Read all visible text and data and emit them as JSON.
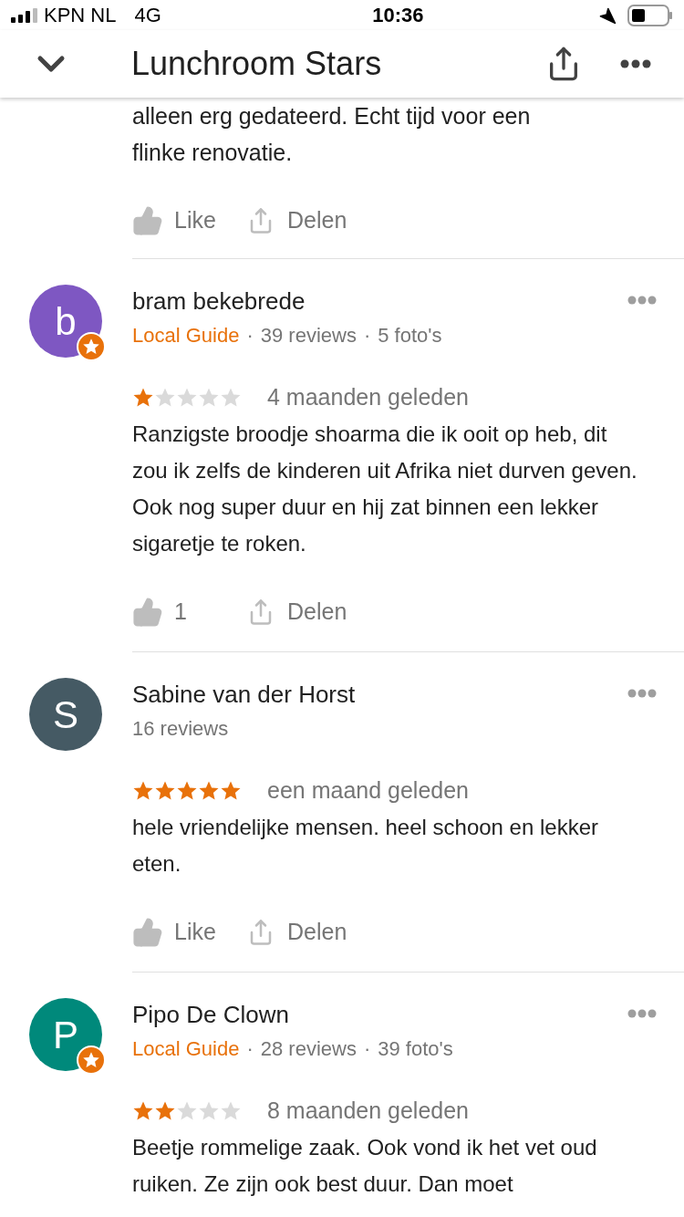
{
  "status_bar": {
    "carrier": "KPN NL",
    "network": "4G",
    "time": "10:36"
  },
  "header": {
    "title": "Lunchroom Stars"
  },
  "partial_review": {
    "text_lines": [
      "alleen erg gedateerd. Echt tijd voor een",
      "flinke renovatie."
    ],
    "like": "Like",
    "share": "Delen"
  },
  "reviews": [
    {
      "initial": "b",
      "color": "#7e57c2",
      "local_guide": true,
      "name": "bram bekebrede",
      "separator": "·",
      "meta": [
        {
          "kind": "guide",
          "text": "Local Guide"
        },
        {
          "kind": "stat",
          "text": "39 reviews"
        },
        {
          "kind": "stat",
          "text": "5 foto's"
        }
      ],
      "stars": 1,
      "time": "4 maanden geleden",
      "text": "Ranzigste broodje shoarma die ik ooit op heb, dit zou ik zelfs de kinderen uit Afrika niet durven geven. Ook nog super duur en hij zat binnen een lekker sigaretje te roken.",
      "like": "1",
      "share": "Delen"
    },
    {
      "initial": "S",
      "color": "#455a64",
      "local_guide": false,
      "name": "Sabine van der Horst",
      "meta": [
        {
          "kind": "stat",
          "text": "16 reviews"
        }
      ],
      "stars": 5,
      "time": "een maand geleden",
      "text": "hele vriendelijke mensen. heel schoon en lekker eten.",
      "like": "Like",
      "share": "Delen"
    },
    {
      "initial": "P",
      "color": "#00897b",
      "local_guide": true,
      "name": "Pipo De Clown",
      "separator": "·",
      "meta": [
        {
          "kind": "guide",
          "text": "Local Guide"
        },
        {
          "kind": "stat",
          "text": "28 reviews"
        },
        {
          "kind": "stat",
          "text": "39 foto's"
        }
      ],
      "stars": 2,
      "time": "8 maanden geleden",
      "text": "Beetje rommelige zaak. Ook vond ik het vet oud ruiken. Ze zijn ook best duur. Dan moet"
    }
  ]
}
